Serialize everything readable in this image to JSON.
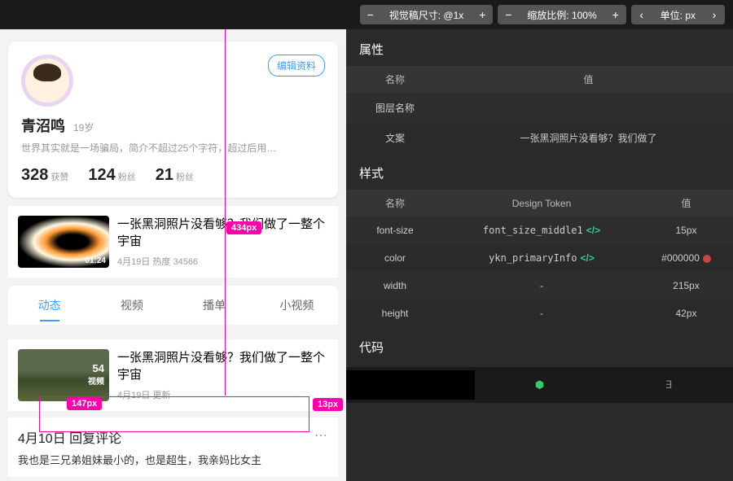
{
  "toolbar": {
    "visual_size_label": "视觉稿尺寸: @1x",
    "zoom_label": "缩放比例: 100%",
    "unit_label": "单位: px"
  },
  "profile": {
    "name": "青沼鸣",
    "age": "19岁",
    "bio": "世界其实就是一场骗局，简介不超过25个字符，超过后用…",
    "edit_label": "编辑资料",
    "stats": [
      {
        "num": "328",
        "label": "获赞"
      },
      {
        "num": "124",
        "label": "粉丝"
      },
      {
        "num": "21",
        "label": "粉丝"
      }
    ]
  },
  "posts": [
    {
      "title": "一张黑洞照片没看够？我们做了一整个宇宙",
      "date": "4月19日  热度 34566",
      "duration": "01:24"
    },
    {
      "title": "一张黑洞照片没看够？我们做了一整个宇宙",
      "date": "4月19日  更新",
      "count": "54",
      "count_label": "视频"
    }
  ],
  "tabs": [
    "动态",
    "视频",
    "播单",
    "小视频"
  ],
  "comment": {
    "title": "4月10日 回复评论",
    "body": "我也是三兄弟姐妹最小的，也是超生，我亲妈比女主"
  },
  "measurements": {
    "b1": "434px",
    "b2": "147px",
    "b3": "13px"
  },
  "inspector": {
    "attrs_title": "属性",
    "style_title": "样式",
    "code_title": "代码",
    "headers": {
      "name": "名称",
      "value": "值",
      "token": "Design Token"
    },
    "attrs": [
      {
        "name": "图层名称",
        "value": ""
      },
      {
        "name": "文案",
        "value": "一张黑洞照片没看够？我们做了"
      }
    ],
    "styles": [
      {
        "name": "font-size",
        "token": "font_size_middle1",
        "value": "15px"
      },
      {
        "name": "color",
        "token": "ykn_primaryInfo",
        "value": "#000000",
        "has_dot": true
      },
      {
        "name": "width",
        "token": "-",
        "value": "215px"
      },
      {
        "name": "height",
        "token": "-",
        "value": "42px"
      }
    ]
  }
}
